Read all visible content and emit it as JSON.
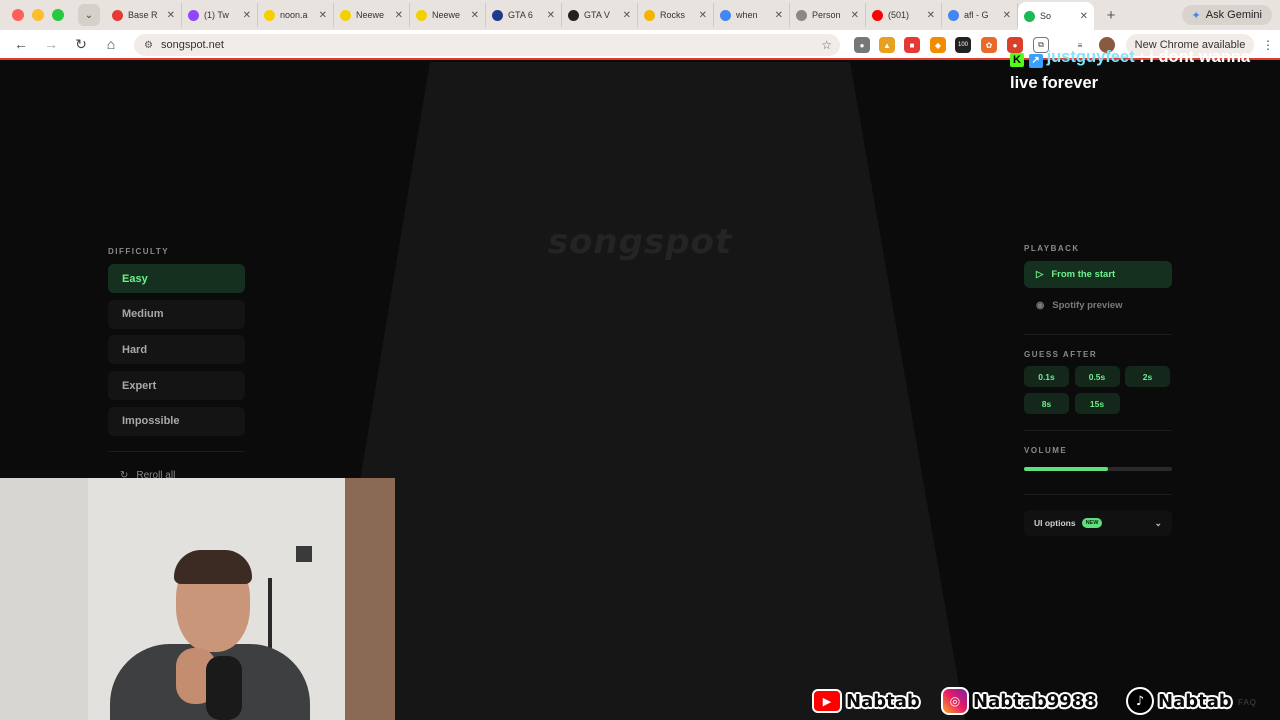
{
  "tabs": [
    {
      "title": "Base R",
      "color": "#e53935"
    },
    {
      "title": "(1) Tw",
      "color": "#9146ff"
    },
    {
      "title": "noon.a",
      "color": "#f5d000"
    },
    {
      "title": "Neewe",
      "color": "#f5d000"
    },
    {
      "title": "Neewe",
      "color": "#f5d000"
    },
    {
      "title": "GTA 6",
      "color": "#1f3a8a"
    },
    {
      "title": "GTA V",
      "color": "#222222"
    },
    {
      "title": "Rocks",
      "color": "#f4b400"
    },
    {
      "title": "when",
      "color": "#4285f4"
    },
    {
      "title": "Person",
      "color": "#888888"
    },
    {
      "title": "(501)",
      "color": "#ff0000"
    },
    {
      "title": "afl - G",
      "color": "#4285f4"
    },
    {
      "title": "So",
      "color": "#1db954",
      "active": true
    }
  ],
  "browser": {
    "gemini": "Ask Gemini",
    "url": "songspot.net",
    "new_chrome": "New Chrome available",
    "ext_badge": "100"
  },
  "app": {
    "brand": "songspot",
    "difficulty": {
      "label": "DIFFICULTY",
      "options": [
        "Easy",
        "Medium",
        "Hard",
        "Expert",
        "Impossible"
      ],
      "selected": "Easy"
    },
    "reroll": "Reroll all",
    "playback": {
      "label": "PLAYBACK",
      "from_start": "From the start",
      "spotify_preview": "Spotify preview"
    },
    "guess_after": {
      "label": "GUESS AFTER",
      "options": [
        "0.1s",
        "0.5s",
        "2s",
        "8s",
        "15s"
      ]
    },
    "volume": {
      "label": "VOLUME",
      "level": 0.57
    },
    "ui_options": {
      "label": "UI options",
      "badge": "NEW"
    },
    "faq": "FAQ"
  },
  "overlay": {
    "chat_user": "justguyfeet",
    "chat_text": ": i dont wanna live forever",
    "socials": [
      {
        "platform": "youtube",
        "handle": "Nabtab"
      },
      {
        "platform": "instagram",
        "handle": "Nabtab9988"
      },
      {
        "platform": "tiktok",
        "handle": "Nabtab"
      }
    ]
  },
  "colors": {
    "accent": "#6ef08c",
    "chrome_accent": "#e03b2e"
  }
}
